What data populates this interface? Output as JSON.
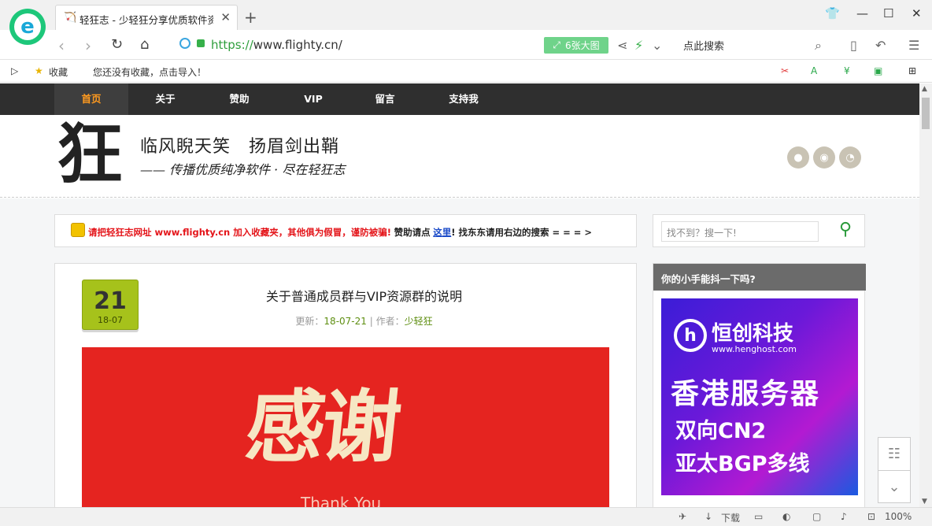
{
  "browser": {
    "tab_title": "轻狂志 - 少轻狂分享优质软件资源",
    "tab_close": "✕",
    "new_tab": "+",
    "url_scheme": "https://",
    "url_host": "www.flighty.cn/",
    "big_image_button": "6张大图",
    "search_placeholder": "点此搜索",
    "bookmarks_label": "收藏",
    "bookmarks_empty": "您还没有收藏，点击导入！",
    "status_download": "下载",
    "status_zoom": "100%"
  },
  "site": {
    "nav": [
      "首页",
      "关于",
      "赞助",
      "VIP",
      "留言",
      "支持我"
    ],
    "slogan": "临风睨天笑　扬眉剑出鞘",
    "subslogan": "—— 传播优质纯净软件 · 尽在轻狂志",
    "notice": {
      "part1": "请把轻狂志网址 www.flighty.cn 加入收藏夹，其他俱为假冒，谨防被骗!",
      "part2": "赞助请点",
      "link": "这里",
      "part3": "! 找东东请用右边的搜索 = = = >"
    },
    "post": {
      "day": "21",
      "month": "18-07",
      "title": "关于普通成员群与VIP资源群的说明",
      "meta_label": "更新：",
      "date": "18-07-21",
      "author_label": " | 作者：",
      "author": "少轻狂",
      "hero_text": "感谢",
      "hero_sub": "Thank You"
    },
    "sidebar": {
      "search_placeholder": "找不到？搜一下!",
      "ad_heading": "你的小手能抖一下吗?",
      "ad_brand": "恒创科技",
      "ad_url": "www.henghost.com",
      "ad_line1": "香港服务器",
      "ad_line2": "双向CN2",
      "ad_line3": "亚太BGP多线"
    }
  }
}
